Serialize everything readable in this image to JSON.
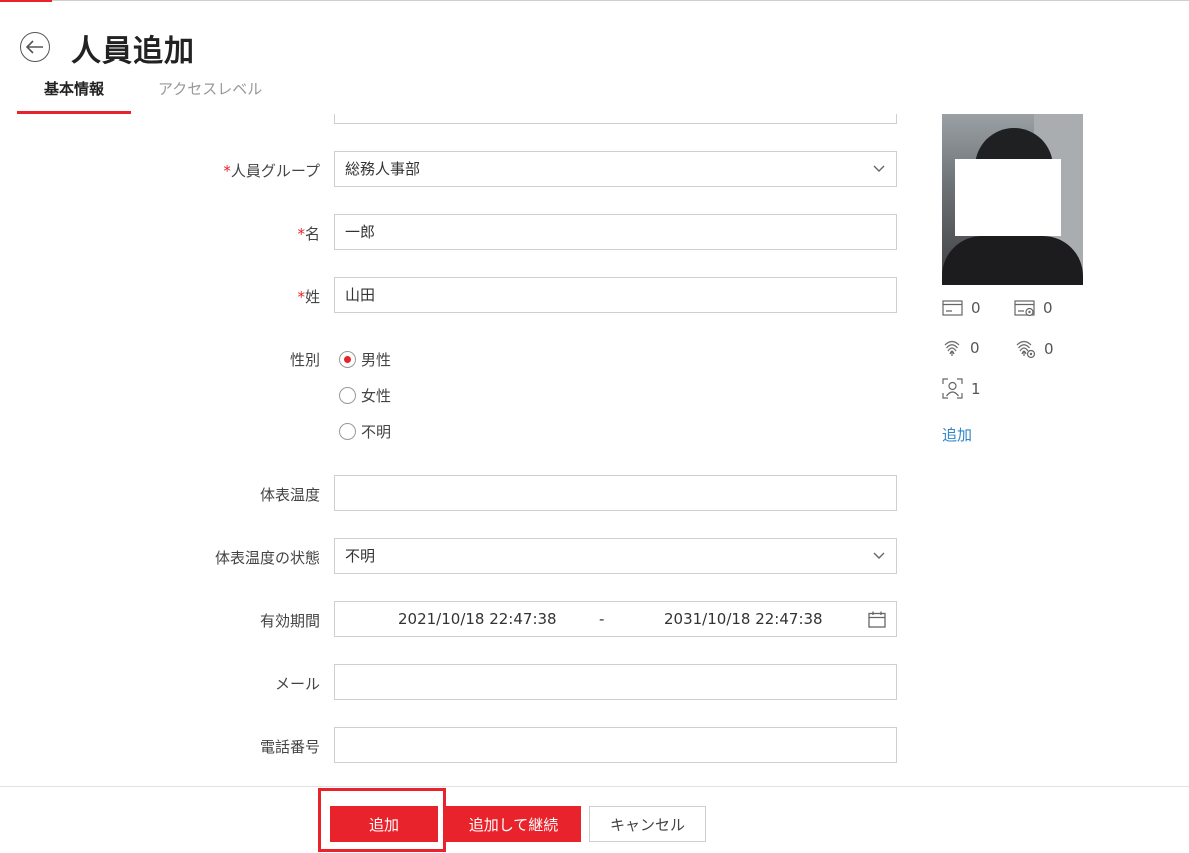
{
  "header": {
    "title": "人員追加",
    "tabs": [
      {
        "label": "基本情報",
        "active": true
      },
      {
        "label": "アクセスレベル",
        "active": false
      }
    ]
  },
  "form": {
    "group": {
      "label": "人員グループ",
      "value": "総務人事部"
    },
    "first_name": {
      "label": "名",
      "value": "一郎"
    },
    "last_name": {
      "label": "姓",
      "value": "山田"
    },
    "gender": {
      "label": "性別",
      "options": [
        "男性",
        "女性",
        "不明"
      ],
      "selected": "男性"
    },
    "temperature": {
      "label": "体表温度",
      "value": ""
    },
    "temperature_status": {
      "label": "体表温度の状態",
      "value": "不明"
    },
    "validity": {
      "label": "有効期間",
      "start": "2021/10/18 22:47:38",
      "separator": "-",
      "end": "2031/10/18 22:47:38"
    },
    "email": {
      "label": "メール",
      "value": ""
    },
    "phone": {
      "label": "電話番号",
      "value": ""
    }
  },
  "credentials": {
    "card_count": "0",
    "card_alt_count": "0",
    "fingerprint_count": "0",
    "fingerprint_alt_count": "0",
    "face_count": "1",
    "add_label": "追加"
  },
  "footer": {
    "add_label": "追加",
    "add_continue_label": "追加して継続",
    "cancel_label": "キャンセル"
  },
  "colors": {
    "accent": "#e8232b",
    "link": "#2f86c9"
  }
}
